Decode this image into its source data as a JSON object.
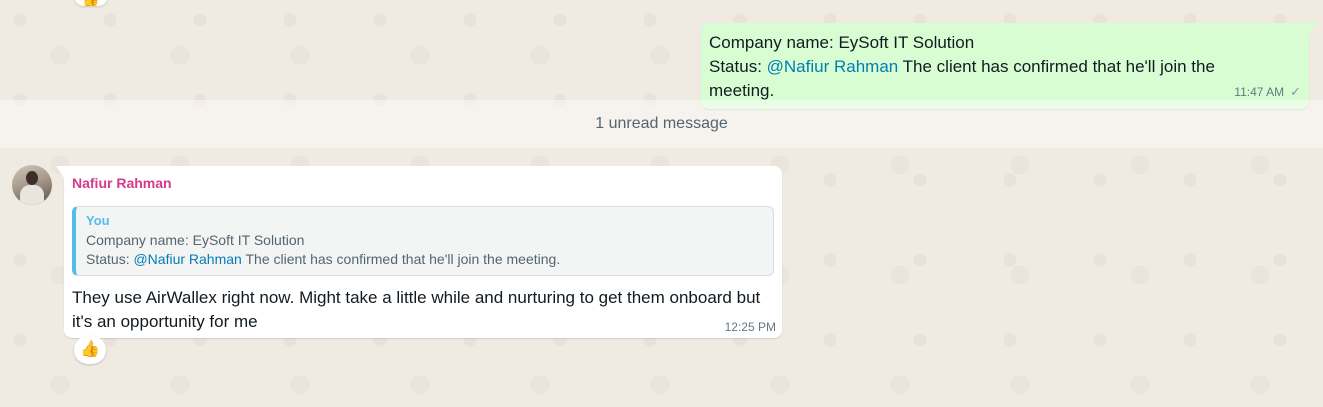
{
  "colors": {
    "chat_background": "#efeae2",
    "outgoing_bubble": "#d9fdd3",
    "incoming_bubble": "#ffffff",
    "mention": "#027eb5",
    "sender_name": "#d63a8c",
    "quote_accent": "#53bdeb"
  },
  "outgoing_message": {
    "line1": "Company name: EySoft IT Solution",
    "status_label": "Status: ",
    "mention": "@Nafiur Rahman",
    "status_text": " The client has confirmed that he'll join the meeting.",
    "time": "11:47 AM",
    "receipt_icon": "single-check-icon"
  },
  "unread_divider": {
    "text": "1 unread message"
  },
  "incoming_message": {
    "sender": "Nafiur Rahman",
    "avatar_icon": "avatar",
    "quote": {
      "author": "You",
      "line1": "Company name: EySoft IT Solution",
      "status_label": "Status: ",
      "mention": "@Nafiur Rahman",
      "status_text": " The client has confirmed that he'll join the meeting."
    },
    "text": "They use AirWallex right now. Might take a little while and nurturing to get them onboard but it's an opportunity for me",
    "time": "12:25 PM",
    "reaction": "👍"
  },
  "top_reaction": "👍"
}
